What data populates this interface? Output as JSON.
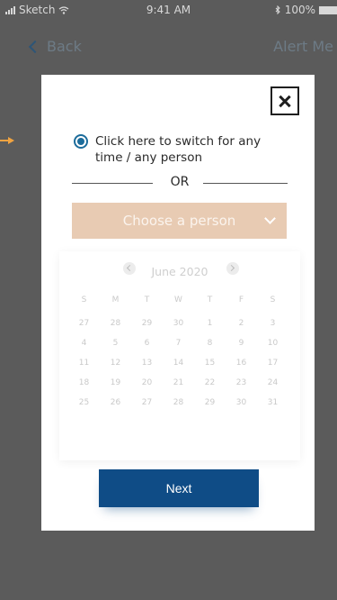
{
  "status_bar": {
    "carrier": "Sketch",
    "time": "9:41 AM",
    "battery": "100%"
  },
  "nav": {
    "back_label": "Back",
    "right_label": "Alert Me"
  },
  "modal": {
    "radio_label": "Click here to switch for any time / any person",
    "divider_text": "OR",
    "person_select": {
      "placeholder": "Choose a person"
    },
    "calendar": {
      "month_label": "June 2020",
      "weekdays": [
        "S",
        "M",
        "T",
        "W",
        "T",
        "F",
        "S"
      ],
      "weeks": [
        [
          "27",
          "28",
          "29",
          "30",
          "1",
          "2",
          "3"
        ],
        [
          "4",
          "5",
          "6",
          "7",
          "8",
          "9",
          "10"
        ],
        [
          "11",
          "12",
          "13",
          "14",
          "15",
          "16",
          "17"
        ],
        [
          "18",
          "19",
          "20",
          "21",
          "22",
          "23",
          "24"
        ],
        [
          "25",
          "26",
          "27",
          "28",
          "29",
          "30",
          "31"
        ]
      ]
    },
    "next_label": "Next"
  },
  "colors": {
    "overlay": "#5b5b5b",
    "accent_blue": "#0f4c86",
    "radio_blue": "#1c6c9b",
    "select_bg": "#e8cbb3",
    "hint_arrow": "#f0a341"
  },
  "icons": [
    "signal-icon",
    "wifi-icon",
    "bluetooth-icon",
    "battery-icon",
    "back-chevron-icon",
    "close-icon",
    "hint-arrow-icon",
    "chevron-down-icon",
    "calendar-prev-icon",
    "calendar-next-icon"
  ]
}
